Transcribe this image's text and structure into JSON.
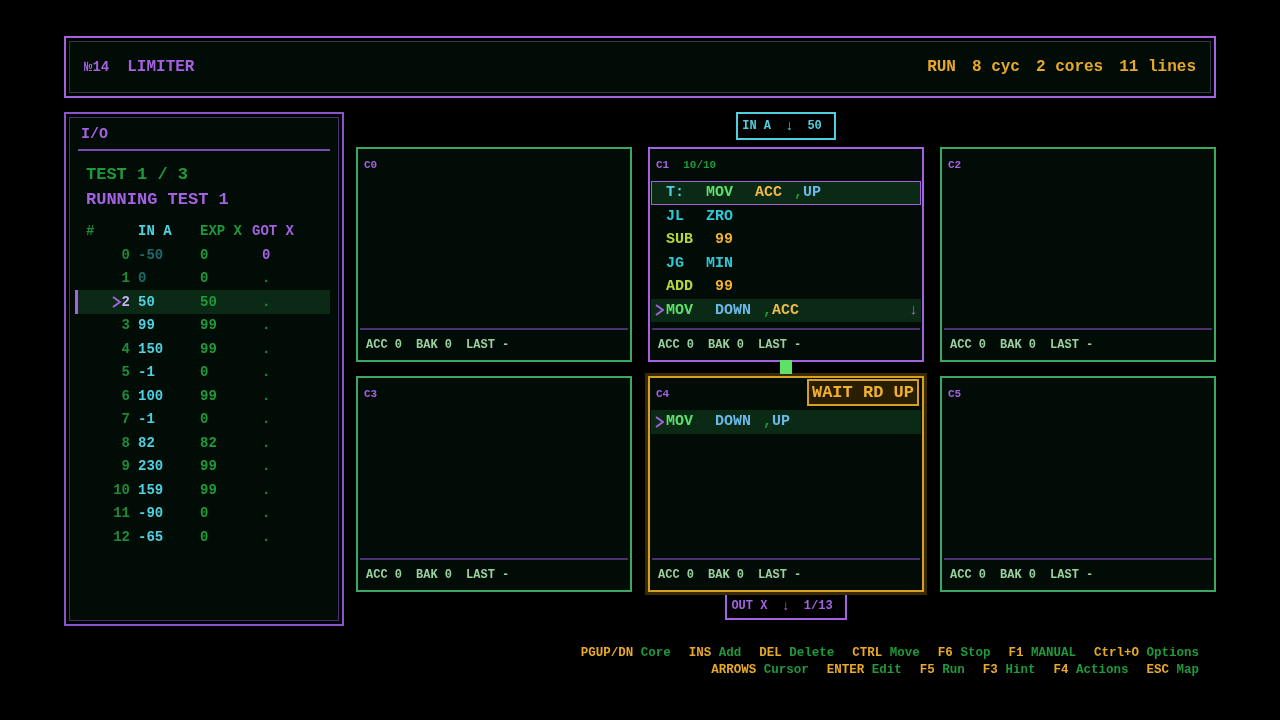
{
  "header": {
    "number": "№14",
    "title": "LIMITER",
    "stats": [
      "RUN",
      "8 cyc",
      "2 cores",
      "11 lines"
    ]
  },
  "io": {
    "title": "I/O",
    "test": "TEST 1 / 3",
    "status": "RUNNING TEST 1",
    "columns": [
      "#",
      "IN A",
      "EXP X",
      "GOT X"
    ],
    "rows": [
      {
        "cells": [
          "0",
          "-50",
          "0",
          "0"
        ],
        "selected": false,
        "consumed": true,
        "received": true
      },
      {
        "cells": [
          "1",
          "0",
          "0",
          "."
        ],
        "selected": false,
        "consumed": true,
        "received": false
      },
      {
        "cells": [
          "2",
          "50",
          "50",
          "."
        ],
        "selected": true,
        "consumed": false,
        "received": false
      },
      {
        "cells": [
          "3",
          "99",
          "99",
          "."
        ],
        "selected": false,
        "consumed": false,
        "received": false
      },
      {
        "cells": [
          "4",
          "150",
          "99",
          "."
        ],
        "selected": false,
        "consumed": false,
        "received": false
      },
      {
        "cells": [
          "5",
          "-1",
          "0",
          "."
        ],
        "selected": false,
        "consumed": false,
        "received": false
      },
      {
        "cells": [
          "6",
          "100",
          "99",
          "."
        ],
        "selected": false,
        "consumed": false,
        "received": false
      },
      {
        "cells": [
          "7",
          "-1",
          "0",
          "."
        ],
        "selected": false,
        "consumed": false,
        "received": false
      },
      {
        "cells": [
          "8",
          "82",
          "82",
          "."
        ],
        "selected": false,
        "consumed": false,
        "received": false
      },
      {
        "cells": [
          "9",
          "230",
          "99",
          "."
        ],
        "selected": false,
        "consumed": false,
        "received": false
      },
      {
        "cells": [
          "10",
          "159",
          "99",
          "."
        ],
        "selected": false,
        "consumed": false,
        "received": false
      },
      {
        "cells": [
          "11",
          "-90",
          "0",
          "."
        ],
        "selected": false,
        "consumed": false,
        "received": false
      },
      {
        "cells": [
          "12",
          "-65",
          "0",
          "."
        ],
        "selected": false,
        "consumed": false,
        "received": false
      }
    ]
  },
  "ports": [
    {
      "kind": "input",
      "name": "IN A",
      "arrow": "↓",
      "value": "50"
    },
    {
      "kind": "output",
      "name": "OUT X",
      "arrow": "↓",
      "value": "1/13"
    }
  ],
  "cores": [
    {
      "name": "C0",
      "selected": false,
      "waiting": false,
      "registers": [
        "ACC 0",
        "BAK 0",
        "LAST -"
      ]
    },
    {
      "name": "C1",
      "count": "10/10",
      "selected": true,
      "waiting": false,
      "registers": [
        "ACC 0",
        "BAK 0",
        "LAST -"
      ],
      "lines": [
        {
          "cursor": true,
          "current": false,
          "tokens": [
            {
              "kind": "label",
              "text": "T:"
            },
            {
              "kind": "op",
              "text": "MOV"
            },
            {
              "kind": "reg",
              "text": "ACC"
            },
            {
              "kind": "sep",
              "text": ","
            },
            {
              "kind": "port",
              "text": "UP"
            }
          ]
        },
        {
          "cursor": false,
          "current": false,
          "tokens": [
            {
              "kind": "jump",
              "text": "JL"
            },
            {
              "kind": "jump",
              "text": "ZRO"
            }
          ]
        },
        {
          "cursor": false,
          "current": false,
          "tokens": [
            {
              "kind": "math",
              "text": "SUB"
            },
            {
              "kind": "num",
              "text": "99"
            }
          ]
        },
        {
          "cursor": false,
          "current": false,
          "tokens": [
            {
              "kind": "jump",
              "text": "JG"
            },
            {
              "kind": "jump",
              "text": "MIN"
            }
          ]
        },
        {
          "cursor": false,
          "current": false,
          "tokens": [
            {
              "kind": "math",
              "text": "ADD"
            },
            {
              "kind": "num",
              "text": "99"
            }
          ]
        },
        {
          "cursor": false,
          "current": true,
          "trail": "↓",
          "tokens": [
            {
              "kind": "op",
              "text": "MOV"
            },
            {
              "kind": "port",
              "text": "DOWN"
            },
            {
              "kind": "sep",
              "text": ","
            },
            {
              "kind": "reg",
              "text": "ACC"
            }
          ]
        }
      ]
    },
    {
      "name": "C2",
      "selected": false,
      "waiting": false,
      "registers": [
        "ACC 0",
        "BAK 0",
        "LAST -"
      ]
    },
    {
      "name": "C3",
      "selected": false,
      "waiting": false,
      "registers": [
        "ACC 0",
        "BAK 0",
        "LAST -"
      ]
    },
    {
      "name": "C4",
      "selected": false,
      "waiting": true,
      "status": "WAIT RD UP",
      "registers": [
        "ACC 0",
        "BAK 0",
        "LAST -"
      ],
      "lines": [
        {
          "cursor": false,
          "current": true,
          "tokens": [
            {
              "kind": "op",
              "text": "MOV"
            },
            {
              "kind": "port",
              "text": "DOWN"
            },
            {
              "kind": "sep",
              "text": ","
            },
            {
              "kind": "port",
              "text": "UP"
            }
          ]
        }
      ]
    },
    {
      "name": "C5",
      "selected": false,
      "waiting": false,
      "registers": [
        "ACC 0",
        "BAK 0",
        "LAST -"
      ]
    }
  ],
  "hints": [
    [
      {
        "key": "PGUP/DN",
        "action": "Core"
      },
      {
        "key": "INS",
        "action": "Add"
      },
      {
        "key": "DEL",
        "action": "Delete"
      },
      {
        "key": "CTRL",
        "action": "Move"
      },
      {
        "key": "F6",
        "action": "Stop"
      },
      {
        "key": "F1",
        "action": "MANUAL"
      },
      {
        "key": "Ctrl+O",
        "action": "Options"
      }
    ],
    [
      {
        "key": "ARROWS",
        "action": "Cursor"
      },
      {
        "key": "ENTER",
        "action": "Edit"
      },
      {
        "key": "F5",
        "action": "Run"
      },
      {
        "key": "F3",
        "action": "Hint"
      },
      {
        "key": "F4",
        "action": "Actions"
      },
      {
        "key": "ESC",
        "action": "Map"
      }
    ]
  ]
}
